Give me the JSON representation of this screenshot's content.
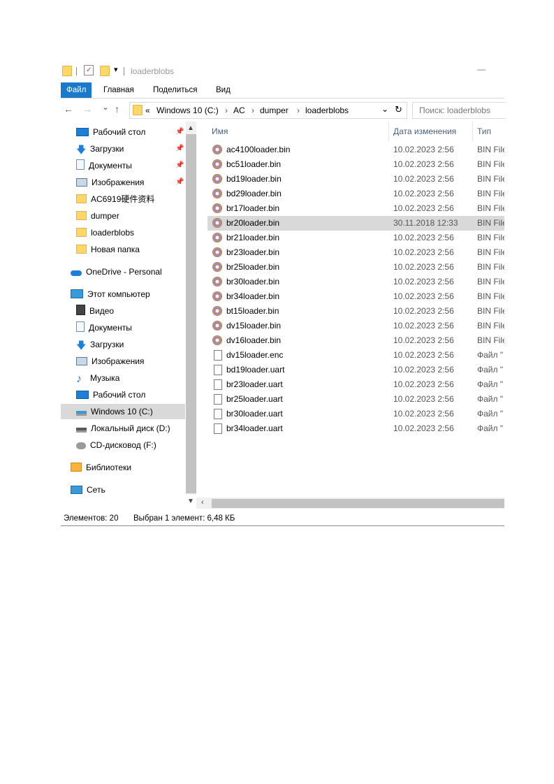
{
  "title": "loaderblobs",
  "titlebar": {
    "qa_dropdown": "▾",
    "minimize": "—"
  },
  "ribbon": {
    "tabs": [
      "Файл",
      "Главная",
      "Поделиться",
      "Вид"
    ]
  },
  "nav": {
    "back": "←",
    "forward": "→",
    "recent": "⌄",
    "up": "↑"
  },
  "address": {
    "overflow": "«",
    "segments": [
      "Windows 10 (C:)",
      "AC",
      "dumper",
      "loaderblobs"
    ],
    "separator": "›",
    "dropdown": "⌄",
    "refresh": "↻"
  },
  "search": {
    "placeholder": "Поиск: loaderblobs"
  },
  "navpane": {
    "quick_access": [
      {
        "label": "Рабочий стол",
        "icon": "desktop-icon",
        "pinned": true
      },
      {
        "label": "Загрузки",
        "icon": "download-icon",
        "pinned": true
      },
      {
        "label": "Документы",
        "icon": "document-icon",
        "pinned": true
      },
      {
        "label": "Изображения",
        "icon": "pictures-icon",
        "pinned": true
      },
      {
        "label": "AC6919硬件资料",
        "icon": "folder-icon",
        "pinned": false
      },
      {
        "label": "dumper",
        "icon": "folder-icon",
        "pinned": false
      },
      {
        "label": "loaderblobs",
        "icon": "folder-icon",
        "pinned": false
      },
      {
        "label": "Новая папка",
        "icon": "folder-icon",
        "pinned": false
      }
    ],
    "onedrive": "OneDrive - Personal",
    "this_pc": "Этот компьютер",
    "pc_items": [
      {
        "label": "Видео",
        "icon": "video-icon"
      },
      {
        "label": "Документы",
        "icon": "document-icon"
      },
      {
        "label": "Загрузки",
        "icon": "download-icon"
      },
      {
        "label": "Изображения",
        "icon": "pictures-icon"
      },
      {
        "label": "Музыка",
        "icon": "music-icon"
      },
      {
        "label": "Рабочий стол",
        "icon": "desktop-icon"
      },
      {
        "label": "Windows 10 (C:)",
        "icon": "windows-drive-icon"
      },
      {
        "label": "Локальный диск (D:)",
        "icon": "drive-icon"
      },
      {
        "label": "CD-дисковод (F:)",
        "icon": "cd-drive-icon"
      }
    ],
    "libraries": "Библиотеки",
    "network": "Сеть",
    "pin_glyph": "📌"
  },
  "columns": {
    "name": "Имя",
    "date": "Дата изменения",
    "type": "Тип"
  },
  "files": [
    {
      "name": "ac4100loader.bin",
      "date": "10.02.2023 2:56",
      "type": "BIN File",
      "kind": "bin"
    },
    {
      "name": "bc51loader.bin",
      "date": "10.02.2023 2:56",
      "type": "BIN File",
      "kind": "bin"
    },
    {
      "name": "bd19loader.bin",
      "date": "10.02.2023 2:56",
      "type": "BIN File",
      "kind": "bin"
    },
    {
      "name": "bd29loader.bin",
      "date": "10.02.2023 2:56",
      "type": "BIN File",
      "kind": "bin"
    },
    {
      "name": "br17loader.bin",
      "date": "10.02.2023 2:56",
      "type": "BIN File",
      "kind": "bin"
    },
    {
      "name": "br20loader.bin",
      "date": "30.11.2018 12:33",
      "type": "BIN File",
      "kind": "bin"
    },
    {
      "name": "br21loader.bin",
      "date": "10.02.2023 2:56",
      "type": "BIN File",
      "kind": "bin"
    },
    {
      "name": "br23loader.bin",
      "date": "10.02.2023 2:56",
      "type": "BIN File",
      "kind": "bin"
    },
    {
      "name": "br25loader.bin",
      "date": "10.02.2023 2:56",
      "type": "BIN File",
      "kind": "bin"
    },
    {
      "name": "br30loader.bin",
      "date": "10.02.2023 2:56",
      "type": "BIN File",
      "kind": "bin"
    },
    {
      "name": "br34loader.bin",
      "date": "10.02.2023 2:56",
      "type": "BIN File",
      "kind": "bin"
    },
    {
      "name": "bt15loader.bin",
      "date": "10.02.2023 2:56",
      "type": "BIN File",
      "kind": "bin"
    },
    {
      "name": "dv15loader.bin",
      "date": "10.02.2023 2:56",
      "type": "BIN File",
      "kind": "bin"
    },
    {
      "name": "dv16loader.bin",
      "date": "10.02.2023 2:56",
      "type": "BIN File",
      "kind": "bin"
    },
    {
      "name": "dv15loader.enc",
      "date": "10.02.2023 2:56",
      "type": "Файл \"",
      "kind": "file"
    },
    {
      "name": "bd19loader.uart",
      "date": "10.02.2023 2:56",
      "type": "Файл \"",
      "kind": "file"
    },
    {
      "name": "br23loader.uart",
      "date": "10.02.2023 2:56",
      "type": "Файл \"",
      "kind": "file"
    },
    {
      "name": "br25loader.uart",
      "date": "10.02.2023 2:56",
      "type": "Файл \"",
      "kind": "file"
    },
    {
      "name": "br30loader.uart",
      "date": "10.02.2023 2:56",
      "type": "Файл \"",
      "kind": "file"
    },
    {
      "name": "br34loader.uart",
      "date": "10.02.2023 2:56",
      "type": "Файл \"",
      "kind": "file"
    }
  ],
  "selected_file": "br20loader.bin",
  "selected_nav": "Windows 10 (C:)",
  "status": {
    "count": "Элементов: 20",
    "selection": "Выбран 1 элемент: 6,48 КБ"
  },
  "colors": {
    "accent": "#1979ca",
    "selection": "#d9d9d9",
    "header_text": "#4c607a"
  }
}
